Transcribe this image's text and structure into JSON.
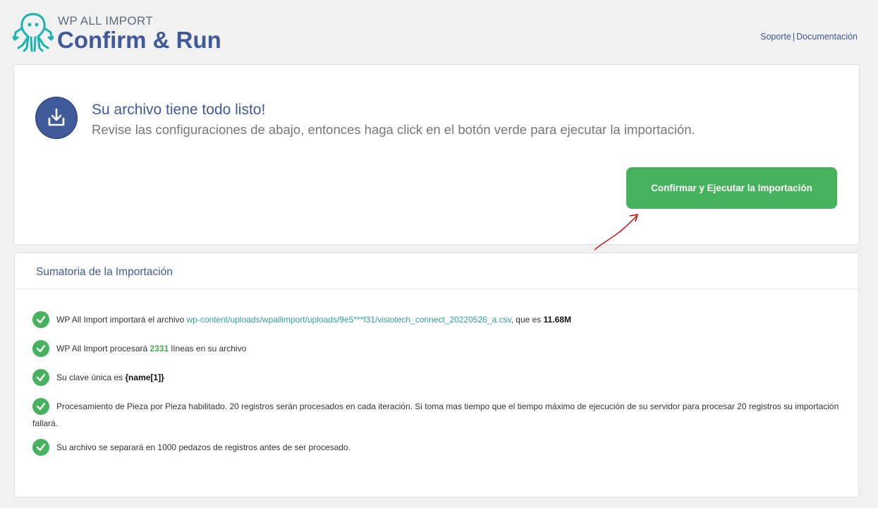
{
  "header": {
    "brand_small": "WP ALL IMPORT",
    "title": "Confirm & Run",
    "support_link": "Soporte",
    "separator": "|",
    "docs_link": "Documentación"
  },
  "ready": {
    "icon": "download-icon",
    "title": "Su archivo tiene todo listo!",
    "subtitle": "Revise las configuraciones de abajo, entonces haga click en el botón verde para ejecutar la importación.",
    "button_label": "Confirmar y Ejecutar la Importación"
  },
  "summary": {
    "title": "Sumatoria de la Importación",
    "items": [
      {
        "prefix": "WP All Import importará el archivo ",
        "file_link": "wp-content/uploads/wpallimport/uploads/9e5***f31/visiotech_connect_20220526_a.csv",
        "middle": ", que es ",
        "size": "11.68M"
      },
      {
        "prefix": "WP All Import procesará ",
        "count": "2331",
        "suffix": " líneas en su archivo"
      },
      {
        "prefix": "Su clave única es ",
        "key": "{name[1]}"
      },
      {
        "text": "Procesamiento de Pieza por Pieza habilitado. 20 registros serán procesados en cada iteración. Si toma mas tiempo que el tiempo máximo de ejecución de su servidor para procesar 20 registros su importación fallará."
      },
      {
        "text": "Su archivo se separará en 1000 pedazos de registros antes de ser procesado."
      }
    ]
  },
  "colors": {
    "brand_blue": "#40599b",
    "accent_green": "#46b25d",
    "link_teal": "#2aa29a",
    "annotation_red": "#d00000"
  }
}
